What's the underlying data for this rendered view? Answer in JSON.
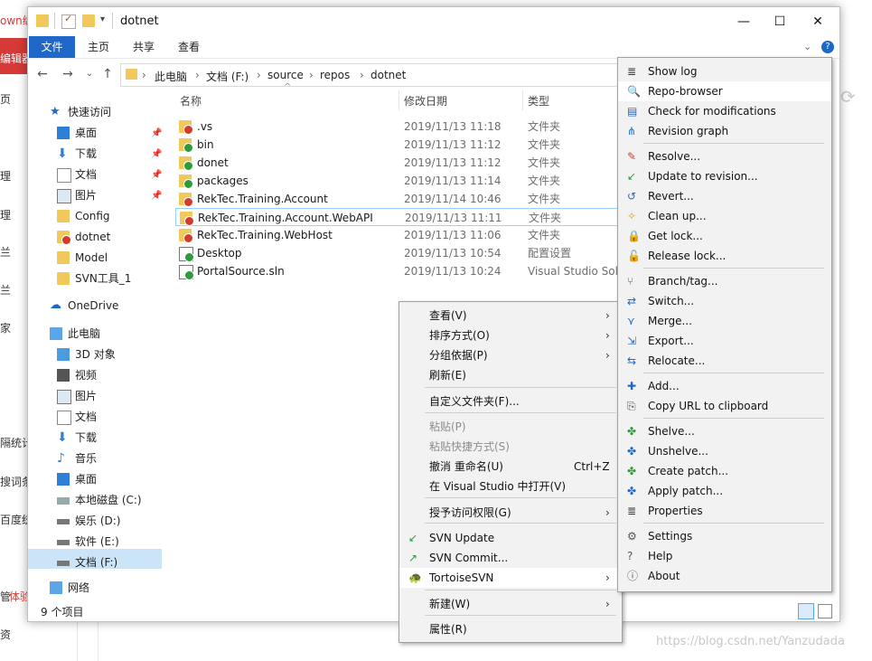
{
  "background_page": {
    "left_snippets": [
      "own编",
      "编辑器",
      "页",
      "理",
      "理",
      "兰",
      "兰",
      "家",
      "隔统计",
      "搜词条",
      "百度统",
      "管",
      "体验",
      "资"
    ]
  },
  "window": {
    "title": "dotnet",
    "controls": {
      "minimize": "—",
      "maximize": "☐",
      "close": "✕"
    }
  },
  "ribbon": {
    "tabs": [
      "文件",
      "主页",
      "共享",
      "查看"
    ]
  },
  "address": {
    "crumbs": [
      "此电脑",
      "文档 (F:)",
      "source",
      "repos",
      "dotnet"
    ],
    "separator": "›"
  },
  "nav_pane": {
    "quick_access": "快速访问",
    "items": [
      "桌面",
      "下载",
      "文档",
      "图片",
      "Config",
      "dotnet",
      "Model",
      "SVN工具_1"
    ],
    "onedrive": "OneDrive",
    "this_pc": "此电脑",
    "pc_items": [
      "3D 对象",
      "视频",
      "图片",
      "文档",
      "下载",
      "音乐",
      "桌面",
      "本地磁盘 (C:)",
      "娱乐 (D:)",
      "软件 (E:)",
      "文档 (F:)"
    ],
    "network": "网络"
  },
  "file_list": {
    "columns": [
      "名称",
      "修改日期",
      "类型"
    ],
    "rows": [
      {
        "name": ".vs",
        "date": "2019/11/13 11:18",
        "type": "文件夹",
        "badge": "red"
      },
      {
        "name": "bin",
        "date": "2019/11/13 11:12",
        "type": "文件夹",
        "badge": "green"
      },
      {
        "name": "donet",
        "date": "2019/11/13 11:12",
        "type": "文件夹",
        "badge": "green"
      },
      {
        "name": "packages",
        "date": "2019/11/13 11:14",
        "type": "文件夹",
        "badge": "green"
      },
      {
        "name": "RekTec.Training.Account",
        "date": "2019/11/14 10:46",
        "type": "文件夹",
        "badge": "red"
      },
      {
        "name": "RekTec.Training.Account.WebAPI",
        "date": "2019/11/13 11:11",
        "type": "文件夹",
        "badge": "red"
      },
      {
        "name": "RekTec.Training.WebHost",
        "date": "2019/11/13 11:06",
        "type": "文件夹",
        "badge": "red"
      },
      {
        "name": "Desktop",
        "date": "2019/11/13 10:54",
        "type": "配置设置",
        "badge": "green"
      },
      {
        "name": "PortalSource.sln",
        "date": "2019/11/13 10:24",
        "type": "Visual Studio Sol...",
        "badge": "green"
      }
    ]
  },
  "status": {
    "count": "9 个项目"
  },
  "context_menu": {
    "items": [
      {
        "label": "查看(V)",
        "arrow": "›"
      },
      {
        "label": "排序方式(O)",
        "arrow": "›"
      },
      {
        "label": "分组依据(P)",
        "arrow": "›"
      },
      {
        "label": "刷新(E)"
      },
      {
        "label": "自定义文件夹(F)..."
      },
      {
        "label": "粘贴(P)"
      },
      {
        "label": "粘贴快捷方式(S)"
      },
      {
        "label": "撤消 重命名(U)",
        "shortcut": "Ctrl+Z"
      },
      {
        "label": "在 Visual Studio 中打开(V)"
      },
      {
        "label": "授予访问权限(G)",
        "arrow": "›"
      },
      {
        "label": "SVN Update"
      },
      {
        "label": "SVN Commit..."
      },
      {
        "label": "TortoiseSVN",
        "arrow": "›"
      },
      {
        "label": "新建(W)",
        "arrow": "›"
      },
      {
        "label": "属性(R)"
      }
    ]
  },
  "tortoise_menu": {
    "items": [
      "Show log",
      "Repo-browser",
      "Check for modifications",
      "Revision graph",
      "Resolve...",
      "Update to revision...",
      "Revert...",
      "Clean up...",
      "Get lock...",
      "Release lock...",
      "Branch/tag...",
      "Switch...",
      "Merge...",
      "Export...",
      "Relocate...",
      "Add...",
      "Copy URL to clipboard",
      "Shelve...",
      "Unshelve...",
      "Create patch...",
      "Apply patch...",
      "Properties",
      "Settings",
      "Help",
      "About"
    ]
  },
  "watermark": "https://blog.csdn.net/Yanzudada",
  "colors": {
    "accent": "#1f68c9",
    "folder": "#f0c95a",
    "svn_ok": "#2f9a3a",
    "svn_modified": "#d43a2c"
  }
}
